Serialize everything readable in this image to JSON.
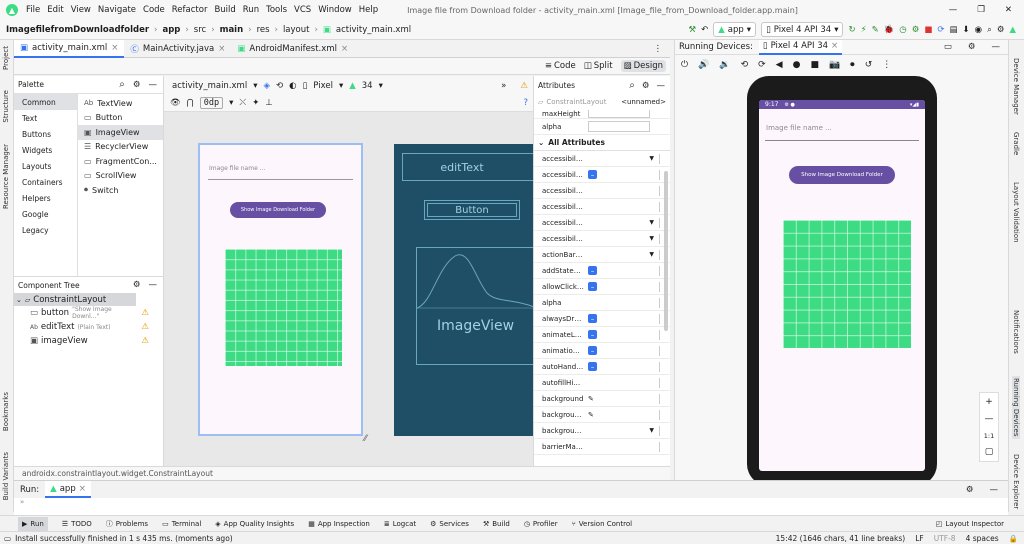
{
  "menu": [
    "File",
    "Edit",
    "View",
    "Navigate",
    "Code",
    "Refactor",
    "Build",
    "Run",
    "Tools",
    "VCS",
    "Window",
    "Help"
  ],
  "window_title": "Image file from Download folder - activity_main.xml [Image_file_from_Download_folder.app.main]",
  "nav": {
    "breadcrumb": [
      "ImagefilefromDownloadfolder",
      "app",
      "src",
      "main",
      "res",
      "layout",
      "activity_main.xml"
    ],
    "run_config": "app",
    "device": "Pixel 4 API 34"
  },
  "tabs": [
    "activity_main.xml",
    "MainActivity.java",
    "AndroidManifest.xml"
  ],
  "view_modes": [
    "Code",
    "Split",
    "Design"
  ],
  "design_toolbar": {
    "file": "activity_main.xml",
    "device": "Pixel",
    "api": "34",
    "margin": "0dp"
  },
  "palette": {
    "title": "Palette",
    "categories": [
      "Common",
      "Text",
      "Buttons",
      "Widgets",
      "Layouts",
      "Containers",
      "Helpers",
      "Google",
      "Legacy"
    ],
    "items": [
      {
        "icon": "Ab",
        "label": "TextView"
      },
      {
        "icon": "▭",
        "label": "Button"
      },
      {
        "icon": "▣",
        "label": "ImageView"
      },
      {
        "icon": "☰",
        "label": "RecyclerView"
      },
      {
        "icon": "▭",
        "label": "FragmentCon..."
      },
      {
        "icon": "▭",
        "label": "ScrollView"
      },
      {
        "icon": "⏺",
        "label": "Switch"
      }
    ]
  },
  "component_tree": {
    "title": "Component Tree",
    "root": "ConstraintLayout",
    "children": [
      {
        "name": "button",
        "hint": "\"Show Image Downl...\""
      },
      {
        "name": "editText",
        "hint": "(Plain Text)"
      },
      {
        "name": "imageView",
        "hint": ""
      }
    ]
  },
  "design_preview": {
    "edit_hint": "Image file name ...",
    "button_label": "Show Image Download Folder"
  },
  "blueprint": {
    "edit_label": "editText",
    "button_label": "Button",
    "image_label": "ImageView"
  },
  "attributes": {
    "title": "Attributes",
    "view_type": "ConstraintLayout",
    "id_value": "<unnamed>",
    "top_rows": [
      "maxHeight",
      "alpha"
    ],
    "section": "All Attributes",
    "rows": [
      {
        "name": "accessibility...",
        "kind": "dropdown"
      },
      {
        "name": "accessibility...",
        "kind": "check"
      },
      {
        "name": "accessibility...",
        "kind": "text"
      },
      {
        "name": "accessibility...",
        "kind": "text"
      },
      {
        "name": "accessibility...",
        "kind": "dropdown"
      },
      {
        "name": "accessibility...",
        "kind": "dropdown"
      },
      {
        "name": "actionBarN...",
        "kind": "dropdown"
      },
      {
        "name": "addStatesFr...",
        "kind": "check"
      },
      {
        "name": "allowClickW...",
        "kind": "check"
      },
      {
        "name": "alpha",
        "kind": "text"
      },
      {
        "name": "alwaysDraw...",
        "kind": "check"
      },
      {
        "name": "animateLay...",
        "kind": "check"
      },
      {
        "name": "animationC...",
        "kind": "check"
      },
      {
        "name": "autoHandw...",
        "kind": "check"
      },
      {
        "name": "autofillHints",
        "kind": "text"
      },
      {
        "name": "background",
        "kind": "picker"
      },
      {
        "name": "background...",
        "kind": "picker"
      },
      {
        "name": "background...",
        "kind": "dropdown"
      },
      {
        "name": "barrierMar...",
        "kind": "text"
      }
    ]
  },
  "status_path": "androidx.constraintlayout.widget.ConstraintLayout",
  "running_devices": {
    "title": "Running Devices:",
    "device_tab": "Pixel 4 API 34",
    "time": "9:17",
    "edit_hint": "Image file name ...",
    "button_label": "Show Image Download Folder",
    "zoom_label": "1:1"
  },
  "run": {
    "label": "Run:",
    "config": "app"
  },
  "tool_windows": [
    "Run",
    "TODO",
    "Problems",
    "Terminal",
    "App Quality Insights",
    "App Inspection",
    "Logcat",
    "Services",
    "Build",
    "Profiler",
    "Version Control"
  ],
  "layout_inspector": "Layout Inspector",
  "left_strip": [
    "Project",
    "Structure",
    "Resource Manager",
    "Bookmarks",
    "Build Variants"
  ],
  "right_strip": [
    "Device Manager",
    "Gradle",
    "Layout Validation",
    "Notifications",
    "Running Devices",
    "Device Explorer"
  ],
  "status": {
    "message": "Install successfully finished in 1 s 435 ms. (moments ago)",
    "position": "15:42 (1646 chars, 41 line breaks)",
    "line_sep": "LF",
    "encoding": "UTF-8",
    "indent": "4 spaces"
  },
  "colors": {
    "accent": "#3574f0",
    "button_purple": "#6750a4",
    "image_green": "#3ddc84",
    "blueprint": "#1f4f66"
  }
}
